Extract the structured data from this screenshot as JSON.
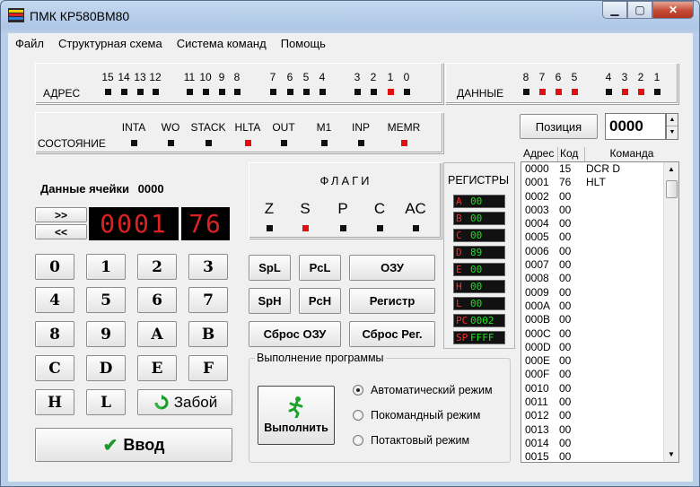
{
  "window": {
    "title": "ПМК КР580ВМ80"
  },
  "menu": [
    "Файл",
    "Структурная схема",
    "Система команд",
    "Помощь"
  ],
  "address": {
    "label": "АДРЕС",
    "bits": [
      {
        "n": "15",
        "on": false
      },
      {
        "n": "14",
        "on": false
      },
      {
        "n": "13",
        "on": false
      },
      {
        "n": "12",
        "on": false
      },
      {
        "n": "11",
        "on": false
      },
      {
        "n": "10",
        "on": false
      },
      {
        "n": "9",
        "on": false
      },
      {
        "n": "8",
        "on": false
      },
      {
        "n": "7",
        "on": false
      },
      {
        "n": "6",
        "on": false
      },
      {
        "n": "5",
        "on": false
      },
      {
        "n": "4",
        "on": false
      },
      {
        "n": "3",
        "on": false
      },
      {
        "n": "2",
        "on": false
      },
      {
        "n": "1",
        "on": true
      },
      {
        "n": "0",
        "on": false
      }
    ]
  },
  "data_bus": {
    "label": "ДАННЫЕ",
    "bits": [
      {
        "n": "8",
        "on": false
      },
      {
        "n": "7",
        "on": true
      },
      {
        "n": "6",
        "on": true
      },
      {
        "n": "5",
        "on": true
      },
      {
        "n": "4",
        "on": false
      },
      {
        "n": "3",
        "on": true
      },
      {
        "n": "2",
        "on": true
      },
      {
        "n": "1",
        "on": false
      }
    ]
  },
  "state": {
    "label": "СОСТОЯНИЕ",
    "signals": [
      {
        "n": "INTA",
        "on": false
      },
      {
        "n": "WO",
        "on": false
      },
      {
        "n": "STACK",
        "on": false
      },
      {
        "n": "HLTA",
        "on": true
      },
      {
        "n": "OUT",
        "on": false
      },
      {
        "n": "M1",
        "on": false
      },
      {
        "n": "INP",
        "on": false
      },
      {
        "n": "MEMR",
        "on": true
      }
    ]
  },
  "position": {
    "button": "Позиция",
    "value": "0000"
  },
  "cell": {
    "label": "Данные ячейки",
    "addr": "0000",
    "display_addr": "0001",
    "display_data": "76",
    "next": ">>",
    "prev": "<<"
  },
  "keypad": {
    "rows": [
      [
        "0",
        "1",
        "2",
        "3"
      ],
      [
        "4",
        "5",
        "6",
        "7"
      ],
      [
        "8",
        "9",
        "A",
        "B"
      ],
      [
        "C",
        "D",
        "E",
        "F"
      ]
    ],
    "h": "H",
    "l": "L",
    "backspace": "Забой",
    "enter": "Ввод"
  },
  "flags": {
    "title": "ФЛАГИ",
    "items": [
      {
        "n": "Z",
        "on": false
      },
      {
        "n": "S",
        "on": true
      },
      {
        "n": "P",
        "on": false
      },
      {
        "n": "C",
        "on": false
      },
      {
        "n": "AC",
        "on": false
      }
    ]
  },
  "registers": {
    "title": "РЕГИСТРЫ",
    "items": [
      {
        "n": "A",
        "v": "00"
      },
      {
        "n": "B",
        "v": "00"
      },
      {
        "n": "C",
        "v": "00"
      },
      {
        "n": "D",
        "v": "89"
      },
      {
        "n": "E",
        "v": "00"
      },
      {
        "n": "H",
        "v": "00"
      },
      {
        "n": "L",
        "v": "00"
      },
      {
        "n": "PC",
        "v": "0002"
      },
      {
        "n": "SP",
        "v": "FFFF"
      }
    ]
  },
  "controls": {
    "spl": "SpL",
    "pcl": "PcL",
    "ram": "ОЗУ",
    "sph": "SpH",
    "pch": "PcH",
    "reg": "Регистр",
    "reset_ram": "Сброс ОЗУ",
    "reset_reg": "Сброс Рег."
  },
  "execution": {
    "group": "Выполнение программы",
    "run": "Выполнить",
    "modes": [
      {
        "label": "Автоматический режим",
        "checked": true
      },
      {
        "label": "Покомандный режим",
        "checked": false
      },
      {
        "label": "Потактовый режим",
        "checked": false
      }
    ]
  },
  "memory": {
    "headers": [
      "Адрес",
      "Код",
      "Команда"
    ],
    "rows": [
      [
        "0000",
        "15",
        "DCR D"
      ],
      [
        "0001",
        "76",
        "HLT"
      ],
      [
        "0002",
        "00",
        ""
      ],
      [
        "0003",
        "00",
        ""
      ],
      [
        "0004",
        "00",
        ""
      ],
      [
        "0005",
        "00",
        ""
      ],
      [
        "0006",
        "00",
        ""
      ],
      [
        "0007",
        "00",
        ""
      ],
      [
        "0008",
        "00",
        ""
      ],
      [
        "0009",
        "00",
        ""
      ],
      [
        "000A",
        "00",
        ""
      ],
      [
        "000B",
        "00",
        ""
      ],
      [
        "000C",
        "00",
        ""
      ],
      [
        "000D",
        "00",
        ""
      ],
      [
        "000E",
        "00",
        ""
      ],
      [
        "000F",
        "00",
        ""
      ],
      [
        "0010",
        "00",
        ""
      ],
      [
        "0011",
        "00",
        ""
      ],
      [
        "0012",
        "00",
        ""
      ],
      [
        "0013",
        "00",
        ""
      ],
      [
        "0014",
        "00",
        ""
      ],
      [
        "0015",
        "00",
        ""
      ]
    ]
  }
}
